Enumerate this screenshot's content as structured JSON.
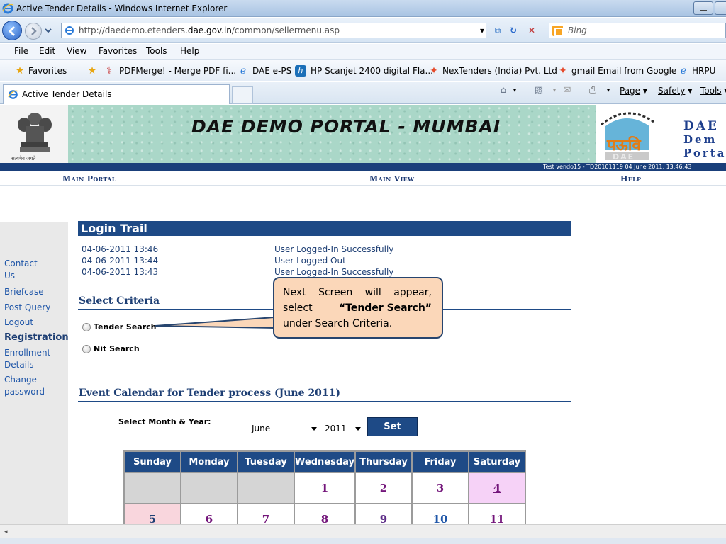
{
  "window": {
    "title": "Active Tender Details - Windows Internet Explorer"
  },
  "address": {
    "url_prefix": "http://daedemo.etenders.",
    "url_domain": "dae.gov.in",
    "url_path": "/common/sellermenu.asp",
    "search_placeholder": "Bing"
  },
  "menu": {
    "items": [
      "File",
      "Edit",
      "View",
      "Favorites",
      "Tools",
      "Help"
    ]
  },
  "favorites": {
    "label": "Favorites",
    "items": [
      "PDFMerge! - Merge PDF fi...",
      "DAE e-PS",
      "HP Scanjet 2400 digital Fla...",
      "NexTenders (India) Pvt. Ltd",
      "gmail Email from Google",
      "HRPU"
    ]
  },
  "tab": {
    "title": "Active Tender Details"
  },
  "commandbar": {
    "page": "Page",
    "safety": "Safety",
    "tools": "Tools"
  },
  "banner": {
    "title": "DAE DEMO PORTAL - MUMBAI",
    "logo_text_lines": [
      "DAE",
      "Dem",
      "Porta"
    ],
    "emblem_caption": "सत्यमेव जयते"
  },
  "session": {
    "text": "Test vendo15 - TD20101119     04 June 2011,  13:46:43"
  },
  "top_nav": {
    "main_portal": "Main Portal",
    "main_view": "Main View",
    "help": "Help"
  },
  "sidebar": {
    "items": [
      {
        "label": "Contact Us",
        "bold": false
      },
      {
        "label": "Briefcase",
        "bold": false
      },
      {
        "label": "Post Query",
        "bold": false
      },
      {
        "label": "Logout",
        "bold": false
      },
      {
        "label": "Registration",
        "bold": true
      },
      {
        "label": "Enrollment Details",
        "bold": false
      },
      {
        "label": "Change password",
        "bold": false
      }
    ]
  },
  "login_trail": {
    "title": "Login Trail",
    "rows": [
      {
        "date": "04-06-2011 13:46",
        "message": "User Logged-In Successfully"
      },
      {
        "date": "04-06-2011 13:44",
        "message": "User Logged Out"
      },
      {
        "date": "04-06-2011 13:43",
        "message": "User Logged-In Successfully"
      }
    ]
  },
  "select_criteria": {
    "title": "Select Criteria",
    "options": [
      "Tender Search",
      "Nit Search"
    ]
  },
  "callout": {
    "line1_words": [
      "Next",
      "Screen",
      "will",
      "appear,"
    ],
    "line2_prefix": "select",
    "line2_bold": "“Tender Search”",
    "line3": "under Search Criteria."
  },
  "calendar": {
    "title": "Event Calendar for Tender process (June 2011)",
    "select_label": "Select Month & Year:",
    "month": "June",
    "year": "2011",
    "set_label": "Set",
    "days": [
      "Sunday",
      "Monday",
      "Tuesday",
      "Wednesday",
      "Thursday",
      "Friday",
      "Saturday"
    ],
    "row1": [
      "",
      "",
      "",
      "1",
      "2",
      "3",
      "4"
    ],
    "row2": [
      "5",
      "6",
      "7",
      "8",
      "9",
      "10",
      "11"
    ]
  },
  "colors": {
    "navy": "#1e4a86",
    "link_blue": "#1f56a8",
    "callout_fill": "#fbd7b9",
    "date_purple": "#73157a"
  }
}
